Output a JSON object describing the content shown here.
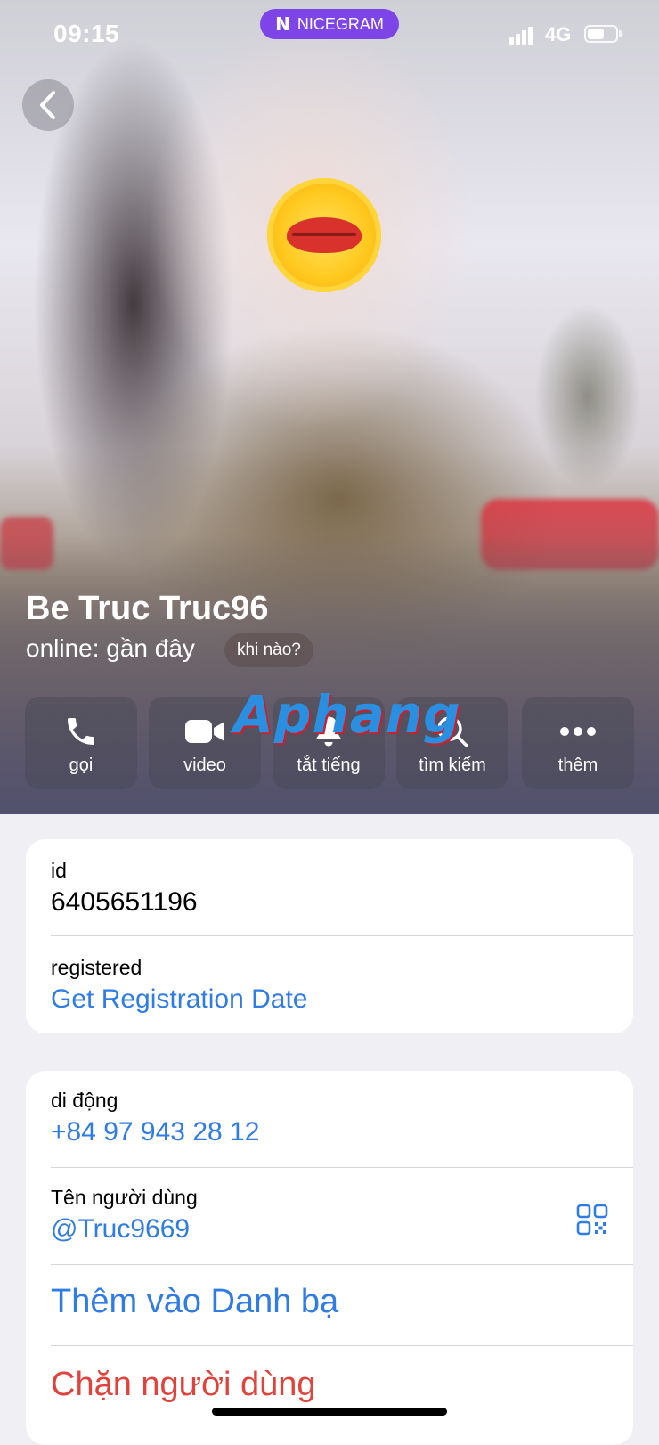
{
  "status_bar": {
    "time": "09:15",
    "app_badge": "NICEGRAM",
    "network": "4G"
  },
  "profile": {
    "name": "Be Truc Truc96",
    "status": "online: gần đây",
    "status_chip": "khi nào?"
  },
  "actions": [
    {
      "label": "gọi",
      "icon": "phone-icon"
    },
    {
      "label": "video",
      "icon": "video-camera-icon"
    },
    {
      "label": "tắt tiếng",
      "icon": "bell-icon"
    },
    {
      "label": "tìm kiếm",
      "icon": "search-icon"
    },
    {
      "label": "thêm",
      "icon": "more-dots-icon"
    }
  ],
  "watermark": "Aphang",
  "info_card": {
    "id_label": "id",
    "id_value": "6405651196",
    "registered_label": "registered",
    "registered_link": "Get Registration Date"
  },
  "contact_card": {
    "phone_label": "di động",
    "phone_value": "+84 97 943 28 12",
    "username_label": "Tên người dùng",
    "username_value": "@Truc9669",
    "add_contact": "Thêm vào Danh bạ",
    "block_user": "Chặn người dùng"
  },
  "colors": {
    "link_blue": "#2f7ce6",
    "destructive_red": "#e0433c",
    "badge_purple": "#7d45e8",
    "background": "#efeff4"
  }
}
